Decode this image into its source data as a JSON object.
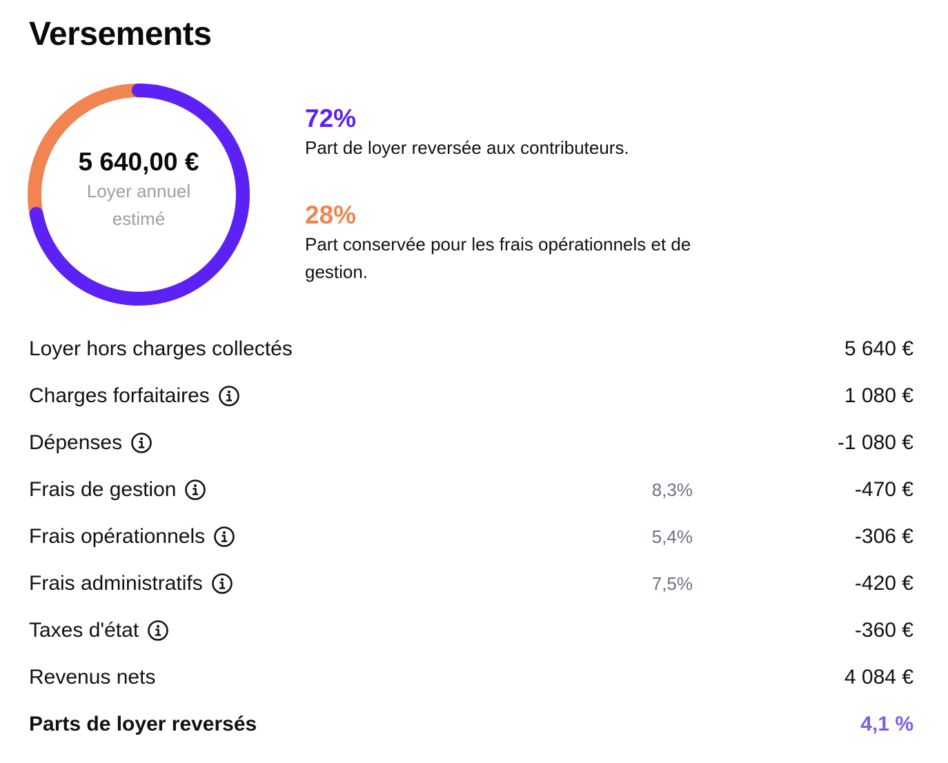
{
  "title": "Versements",
  "colors": {
    "primary": "#5B21F5",
    "secondary": "#F08552",
    "accent_value": "#7C5CF0",
    "muted": "#9aa0a8"
  },
  "donut": {
    "amount": "5 640,00 €",
    "label": "Loyer annuel estimé",
    "primary_fraction": 0.72,
    "secondary_fraction": 0.28
  },
  "legend": [
    {
      "percent": "72%",
      "text": "Part de loyer reversée aux contributeurs."
    },
    {
      "percent": "28%",
      "text": "Part conservée pour les frais opérationnels et de gestion."
    }
  ],
  "rows": [
    {
      "label": "Loyer hors charges collectés",
      "info": false,
      "pct": "",
      "value": "5 640 €"
    },
    {
      "label": "Charges forfaitaires",
      "info": true,
      "pct": "",
      "value": "1 080 €"
    },
    {
      "label": "Dépenses",
      "info": true,
      "pct": "",
      "value": "-1 080 €"
    },
    {
      "label": "Frais de gestion",
      "info": true,
      "pct": "8,3%",
      "value": "-470 €"
    },
    {
      "label": "Frais opérationnels",
      "info": true,
      "pct": "5,4%",
      "value": "-306 €"
    },
    {
      "label": "Frais administratifs",
      "info": true,
      "pct": "7,5%",
      "value": "-420 €"
    },
    {
      "label": "Taxes d'état",
      "info": true,
      "pct": "",
      "value": "-360 €"
    },
    {
      "label": "Revenus nets",
      "info": false,
      "pct": "",
      "value": "4 084 €"
    },
    {
      "label": "Parts de loyer reversés",
      "info": false,
      "pct": "",
      "value": "4,1 %",
      "bold": true
    }
  ]
}
